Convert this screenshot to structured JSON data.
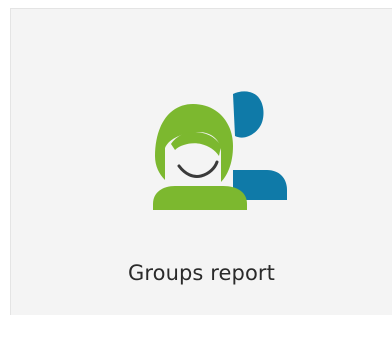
{
  "tile": {
    "label": "Groups report",
    "icon": "groups-icon",
    "colors": {
      "background": "#f4f4f4",
      "front_person": "#7cb82f",
      "back_person": "#0f7aa8",
      "text": "#2a2a2a"
    }
  }
}
